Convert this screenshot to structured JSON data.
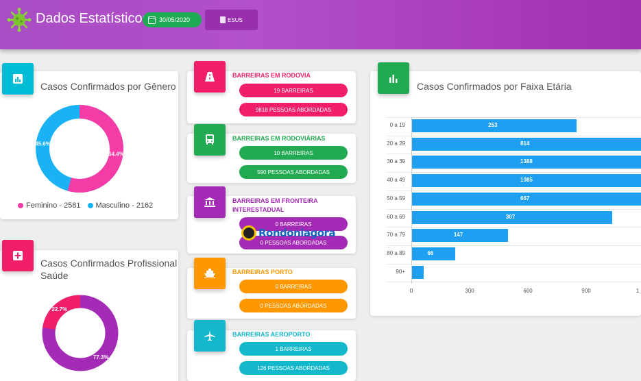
{
  "header": {
    "title": "Dados Estatísticos",
    "date": "30/05/2020",
    "source_button": "ESUS",
    "accent": "#a84dc4"
  },
  "gender_card": {
    "title": "Casos Confirmados por Gênero",
    "slices": [
      {
        "label": "Feminino",
        "value": 2581,
        "percent_label": "54.4%",
        "color": "#f43ba6"
      },
      {
        "label": "Masculino",
        "value": 2162,
        "percent_label": "45.6%",
        "color": "#1ab2f5"
      }
    ],
    "legend_female": "Feminino - 2581",
    "legend_male": "Masculino - 2162"
  },
  "health_card": {
    "title_line1": "Casos Confirmados Profissional",
    "title_line2": "Saúde",
    "slices": [
      {
        "percent": 22.7,
        "percent_label": "22.7%",
        "color": "#f11f6a"
      },
      {
        "percent": 77.3,
        "percent_label": "77.3%",
        "color": "#a42bb5"
      }
    ]
  },
  "barriers": [
    {
      "title": "BARREIRAS EM RODOVIA",
      "count": "19 BARREIRAS",
      "people": "9818 PESSOAS ABORDADAS",
      "color": "#f11f6a"
    },
    {
      "title": "BARREIRAS EM RODOVIÁRIAS",
      "count": "10 BARREIRAS",
      "people": "590 PESSOAS ABORDADAS",
      "color": "#22aa52"
    },
    {
      "title": "BARREIRAS EM FRONTEIRA",
      "title2": "INTERESTADUAL",
      "count": "0 BARREIRAS",
      "people": "0 PESSOAS ABORDADAS",
      "color": "#a42bb5"
    },
    {
      "title": "BARREIRAS PORTO",
      "count": "0 BARREIRAS",
      "people": "0 PESSOAS ABORDADAS",
      "color": "#ff9800"
    },
    {
      "title": "BARREIRAS AEROPORTO",
      "count": "1 BARREIRAS",
      "people": "126 PESSOAS ABORDADAS",
      "color": "#13b8cc"
    }
  ],
  "watermark": "Rondoniagora",
  "age_card": {
    "title": "Casos Confirmados por Faixa Etária"
  },
  "chart_data": {
    "type": "bar",
    "orientation": "horizontal",
    "categories": [
      "0 a 19",
      "20 a 29",
      "30 a 39",
      "40 a 49",
      "50 a 59",
      "60 a 69",
      "70 a 79",
      "80 a 89",
      "90+"
    ],
    "values": [
      253,
      814,
      1388,
      1085,
      667,
      307,
      147,
      66,
      18
    ],
    "value_labels": [
      "253",
      "814",
      "1388",
      "1085",
      "667",
      "307",
      "147",
      "66",
      ""
    ],
    "xticks": [
      "0",
      "300",
      "600",
      "900",
      "1"
    ],
    "xlim": [
      0,
      1200
    ],
    "color": "#1e9ff2",
    "grid": true
  }
}
